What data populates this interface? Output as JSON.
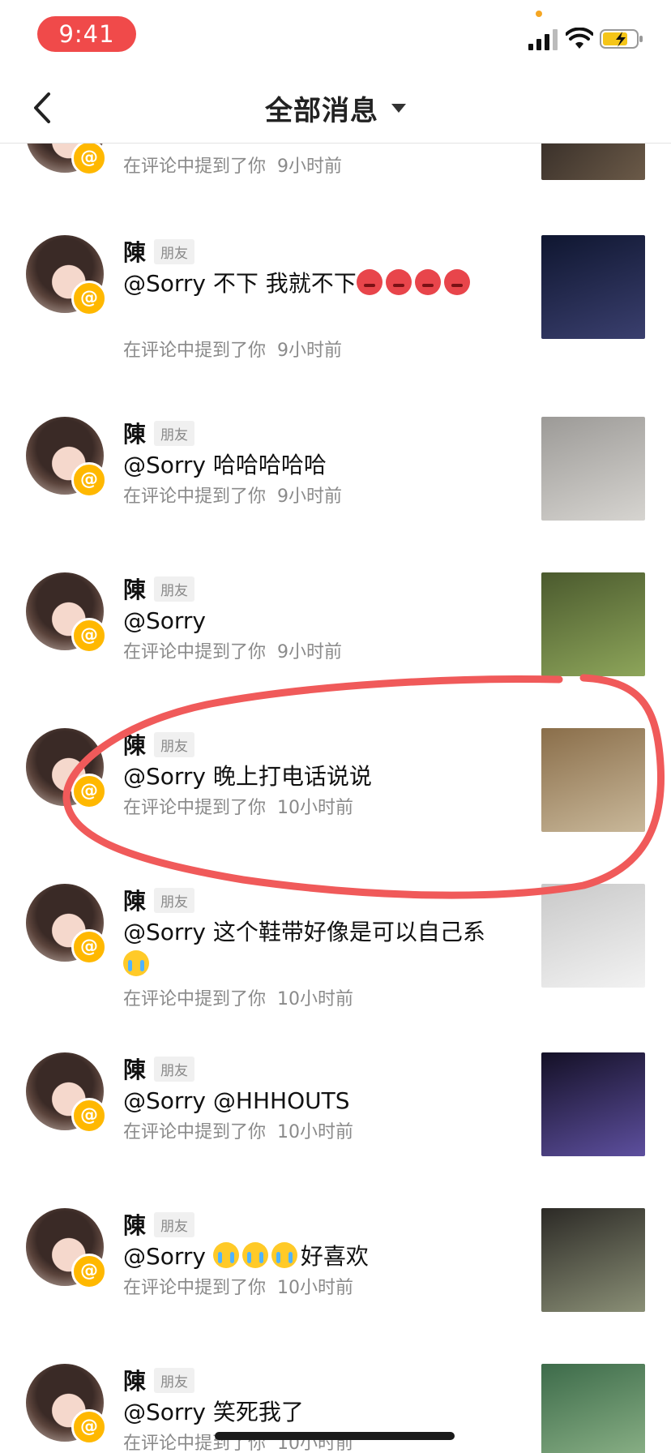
{
  "status_bar": {
    "time": "9:41"
  },
  "nav": {
    "title": "全部消息"
  },
  "items": [
    {
      "name": "陳",
      "tag": "朋友",
      "message": "@Sorry 不下 我就不下",
      "emojis": [
        "angry-emoji",
        "angry-emoji",
        "angry-emoji",
        "angry-emoji"
      ],
      "meta": "在评论中提到了你",
      "ago": "9小时前",
      "thumb_colors": [
        "#0f1630",
        "#3a3f6e"
      ]
    },
    {
      "name": "陳",
      "tag": "朋友",
      "message": "@Sorry 哈哈哈哈哈",
      "emojis": [],
      "meta": "在评论中提到了你",
      "ago": "9小时前",
      "thumb_colors": [
        "#9c9a97",
        "#d6d4d0"
      ]
    },
    {
      "name": "陳",
      "tag": "朋友",
      "message": "@Sorry",
      "emojis": [],
      "meta": "在评论中提到了你",
      "ago": "9小时前",
      "thumb_colors": [
        "#4b5a2e",
        "#8da55a"
      ]
    },
    {
      "name": "陳",
      "tag": "朋友",
      "message": "@Sorry 晚上打电话说说",
      "emojis": [],
      "meta": "在评论中提到了你",
      "ago": "10小时前",
      "thumb_colors": [
        "#8a6e4a",
        "#c9b89a"
      ]
    },
    {
      "name": "陳",
      "tag": "朋友",
      "message": "@Sorry 这个鞋带好像是可以自己系",
      "emojis": [
        "crying-emoji"
      ],
      "meta": "在评论中提到了你",
      "ago": "10小时前",
      "thumb_colors": [
        "#c9c9c9",
        "#f2f2f2"
      ]
    },
    {
      "name": "陳",
      "tag": "朋友",
      "message": "@Sorry @HHHOUTS",
      "emojis": [],
      "meta": "在评论中提到了你",
      "ago": "10小时前",
      "thumb_colors": [
        "#141026",
        "#5d4f9e"
      ]
    },
    {
      "name": "陳",
      "tag": "朋友",
      "message": "@Sorry ",
      "emojis": [
        "crying-emoji",
        "crying-emoji",
        "crying-emoji"
      ],
      "message_after": "好喜欢",
      "meta": "在评论中提到了你",
      "ago": "10小时前",
      "thumb_colors": [
        "#2c2a26",
        "#8a8f76"
      ]
    },
    {
      "name": "陳",
      "tag": "朋友",
      "message": "@Sorry 笑死我了",
      "emojis": [],
      "meta": "在评论中提到了你",
      "ago": "10小时前",
      "thumb_colors": [
        "#3d6b4a",
        "#8fb58a"
      ]
    }
  ],
  "partial_top_item": {
    "meta": "在评论中提到了你",
    "ago": "9小时前"
  },
  "colors": {
    "accent_red": "#f04a4a",
    "badge_yellow": "#ffb800",
    "annotation_red": "#f05a5a"
  }
}
